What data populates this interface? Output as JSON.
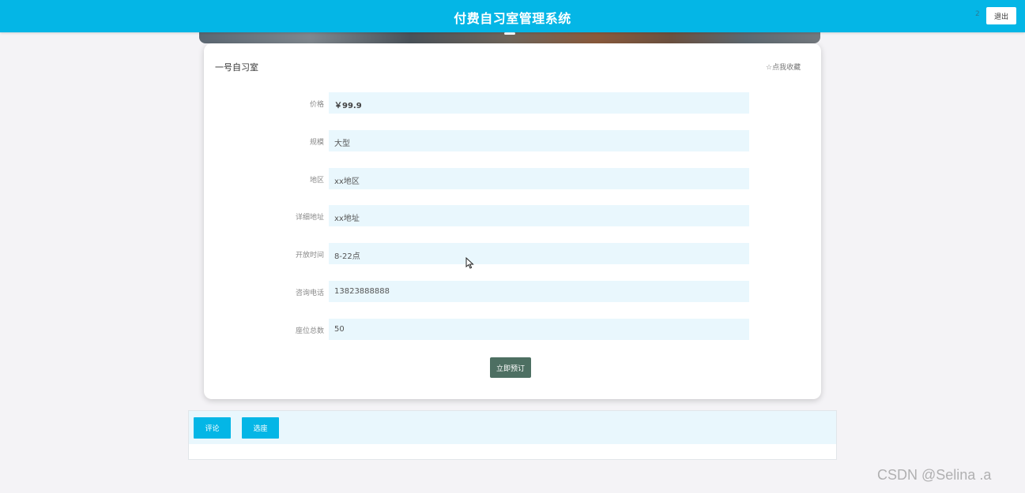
{
  "header": {
    "title": "付费自习室管理系统",
    "user": "2",
    "logout_label": "退出"
  },
  "room": {
    "name": "一号自习室",
    "favorite_label": "☆点我收藏",
    "fields": [
      {
        "label": "价格",
        "value": "￥99.9"
      },
      {
        "label": "规模",
        "value": "大型"
      },
      {
        "label": "地区",
        "value": "xx地区"
      },
      {
        "label": "详细地址",
        "value": "xx地址"
      },
      {
        "label": "开放时间",
        "value": "8-22点"
      },
      {
        "label": "咨询电话",
        "value": "13823888888"
      },
      {
        "label": "座位总数",
        "value": "50"
      }
    ],
    "book_label": "立即预订"
  },
  "tabs": {
    "comment_label": "评论",
    "seat_label": "选座"
  },
  "watermark": "CSDN @Selina .a",
  "colors": {
    "accent": "#04b6e6",
    "book_button": "#4d6f62",
    "field_bg": "#e9f7fd"
  }
}
